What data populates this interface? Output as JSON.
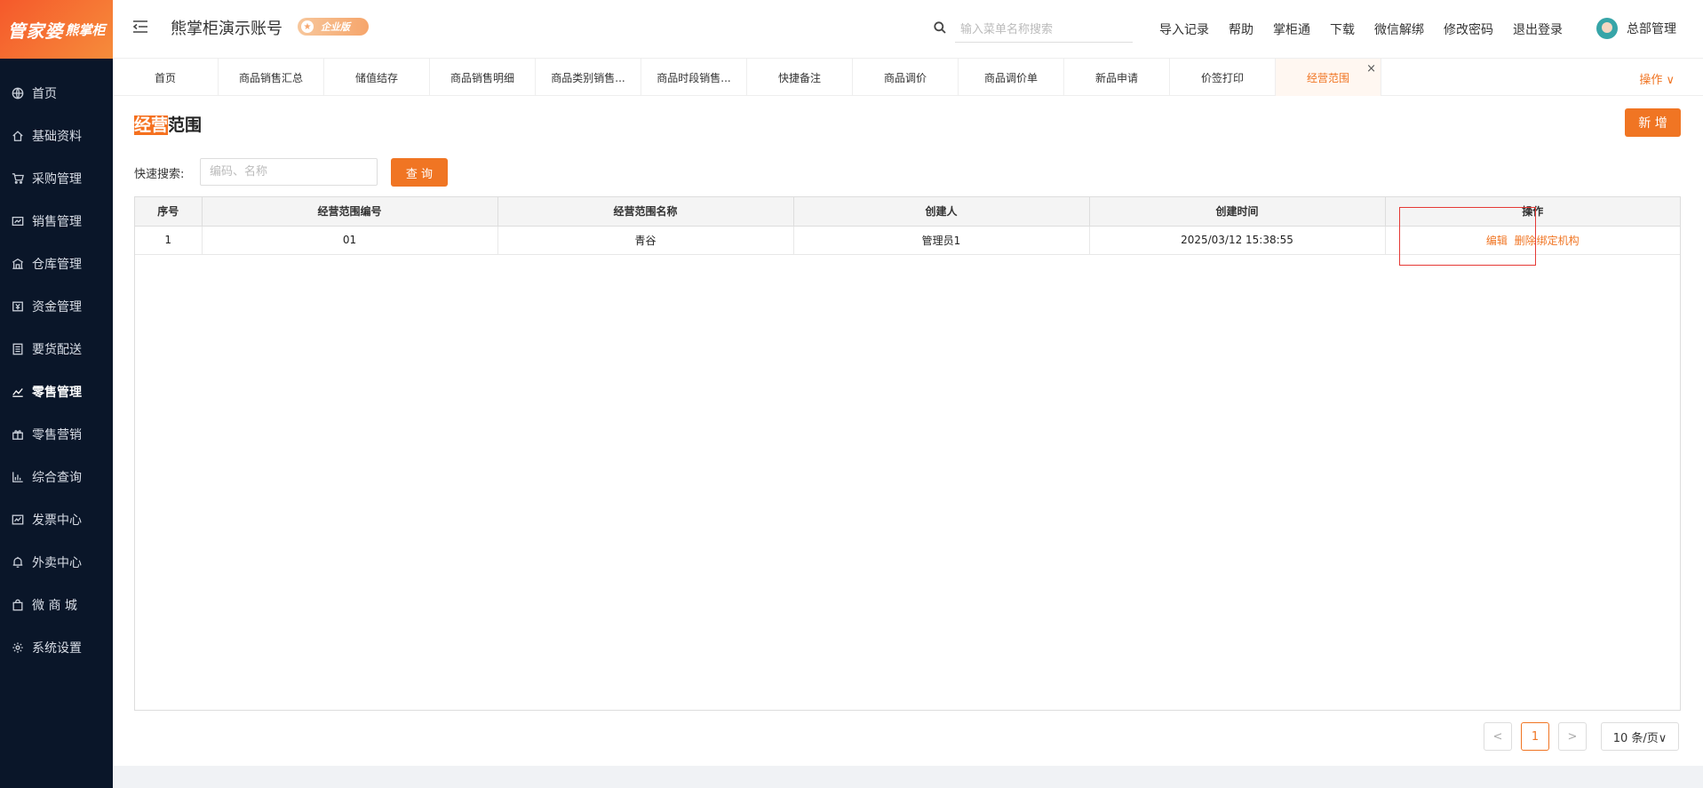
{
  "sidebar": {
    "logo_main": "管家婆",
    "logo_sub": "熊掌柜",
    "items": [
      {
        "label": "首页",
        "icon": "globe-icon"
      },
      {
        "label": "基础资料",
        "icon": "home-icon"
      },
      {
        "label": "采购管理",
        "icon": "cart-icon"
      },
      {
        "label": "销售管理",
        "icon": "sales-icon"
      },
      {
        "label": "仓库管理",
        "icon": "warehouse-icon"
      },
      {
        "label": "资金管理",
        "icon": "funds-icon"
      },
      {
        "label": "要货配送",
        "icon": "list-icon"
      },
      {
        "label": "零售管理",
        "icon": "chart-icon"
      },
      {
        "label": "零售营销",
        "icon": "gift-icon"
      },
      {
        "label": "综合查询",
        "icon": "bar-chart-icon"
      },
      {
        "label": "发票中心",
        "icon": "invoice-icon"
      },
      {
        "label": "外卖中心",
        "icon": "bell-icon"
      },
      {
        "label": "微 商 城",
        "icon": "bag-icon"
      },
      {
        "label": "系统设置",
        "icon": "gear-icon"
      }
    ]
  },
  "header": {
    "account_title": "熊掌柜演示账号",
    "edition_badge": "企业版",
    "search_placeholder": "输入菜单名称搜索",
    "links": [
      "导入记录",
      "帮助",
      "掌柜通",
      "下载",
      "微信解绑",
      "修改密码",
      "退出登录"
    ],
    "user_name": "总部管理"
  },
  "tabs": {
    "items": [
      "首页",
      "商品销售汇总",
      "储值结存",
      "商品销售明细",
      "商品类别销售...",
      "商品时段销售...",
      "快捷备注",
      "商品调价",
      "商品调价单",
      "新品申请",
      "价签打印",
      "经营范围"
    ],
    "ops_label": "操作 ∨",
    "close": "×"
  },
  "page": {
    "title_hl": "经营",
    "title_rest": "范围",
    "add_label": "新 增",
    "quick_search_label": "快速搜索:",
    "quick_search_placeholder": "编码、名称",
    "query_label": "查 询"
  },
  "table": {
    "headers": [
      "序号",
      "经营范围编号",
      "经营范围名称",
      "创建人",
      "创建时间",
      "操作"
    ],
    "rows": [
      {
        "seq": "1",
        "code": "01",
        "name": "青谷",
        "creator": "管理员1",
        "created_at": "2025/03/12 15:38:55",
        "actions": [
          "编辑",
          "删除",
          "绑定机构"
        ]
      }
    ]
  },
  "pagination": {
    "prev": "<",
    "current": "1",
    "next": ">",
    "page_size": "10 条/页∨"
  },
  "colors": {
    "accent": "#f07523",
    "sidebar_bg": "#0a1629"
  }
}
